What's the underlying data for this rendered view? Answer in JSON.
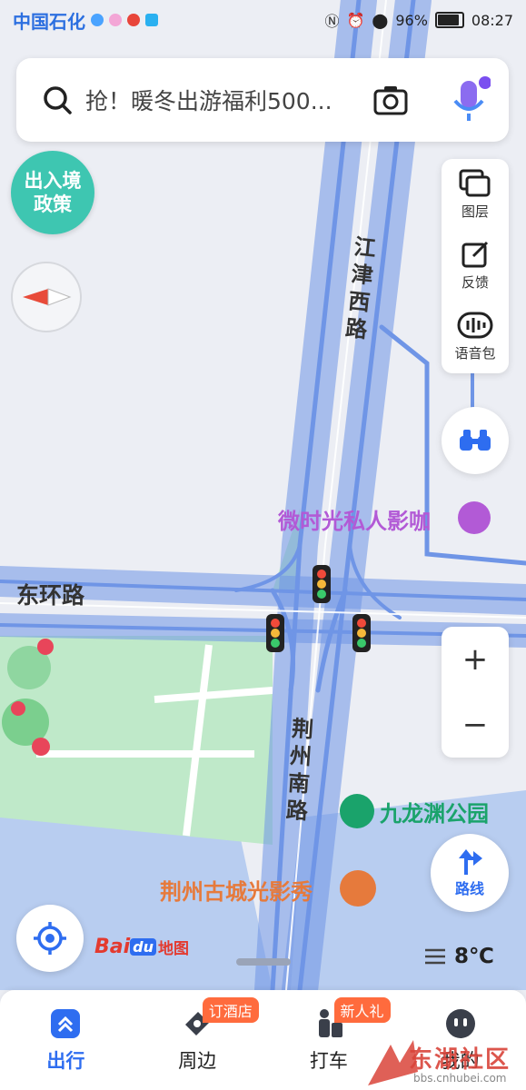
{
  "status_bar": {
    "carrier": "中国石化",
    "battery": "96%",
    "battery_level": 0.96,
    "time": "08:27"
  },
  "search": {
    "placeholder": "抢！暖冬出游福利500..."
  },
  "policy_badge": {
    "line1": "出入境",
    "line2": "政策"
  },
  "tools": {
    "layers": "图层",
    "feedback": "反馈",
    "voice_pack": "语音包"
  },
  "map_labels": {
    "road_jiangjin": "江津西路",
    "road_donghuan": "东环路",
    "road_jingzhou": "荆州南路",
    "poi_cafe": "微时光私人影咖",
    "poi_park": "九龙渊公园",
    "poi_show": "荆州古城光影秀"
  },
  "zoom": {
    "in": "+",
    "out": "−"
  },
  "route_button": "路线",
  "logo": {
    "text": "Bai",
    "du": "du",
    "sub": "地图"
  },
  "weather": {
    "temperature": "8℃"
  },
  "tabs": [
    {
      "label": "出行",
      "badge": ""
    },
    {
      "label": "周边",
      "badge": "订酒店"
    },
    {
      "label": "打车",
      "badge": "新人礼"
    },
    {
      "label": "我的",
      "badge": ""
    }
  ],
  "watermark": {
    "text": "东湖社区",
    "url": "bbs.cnhubei.com"
  },
  "colors": {
    "accent": "#2e6df0",
    "road": "#6f95e6",
    "park": "#bfe9c9",
    "water": "#b8cdf0",
    "poi_purple": "#b25ad6",
    "poi_green": "#1aa36b",
    "poi_orange": "#e67a3c"
  }
}
